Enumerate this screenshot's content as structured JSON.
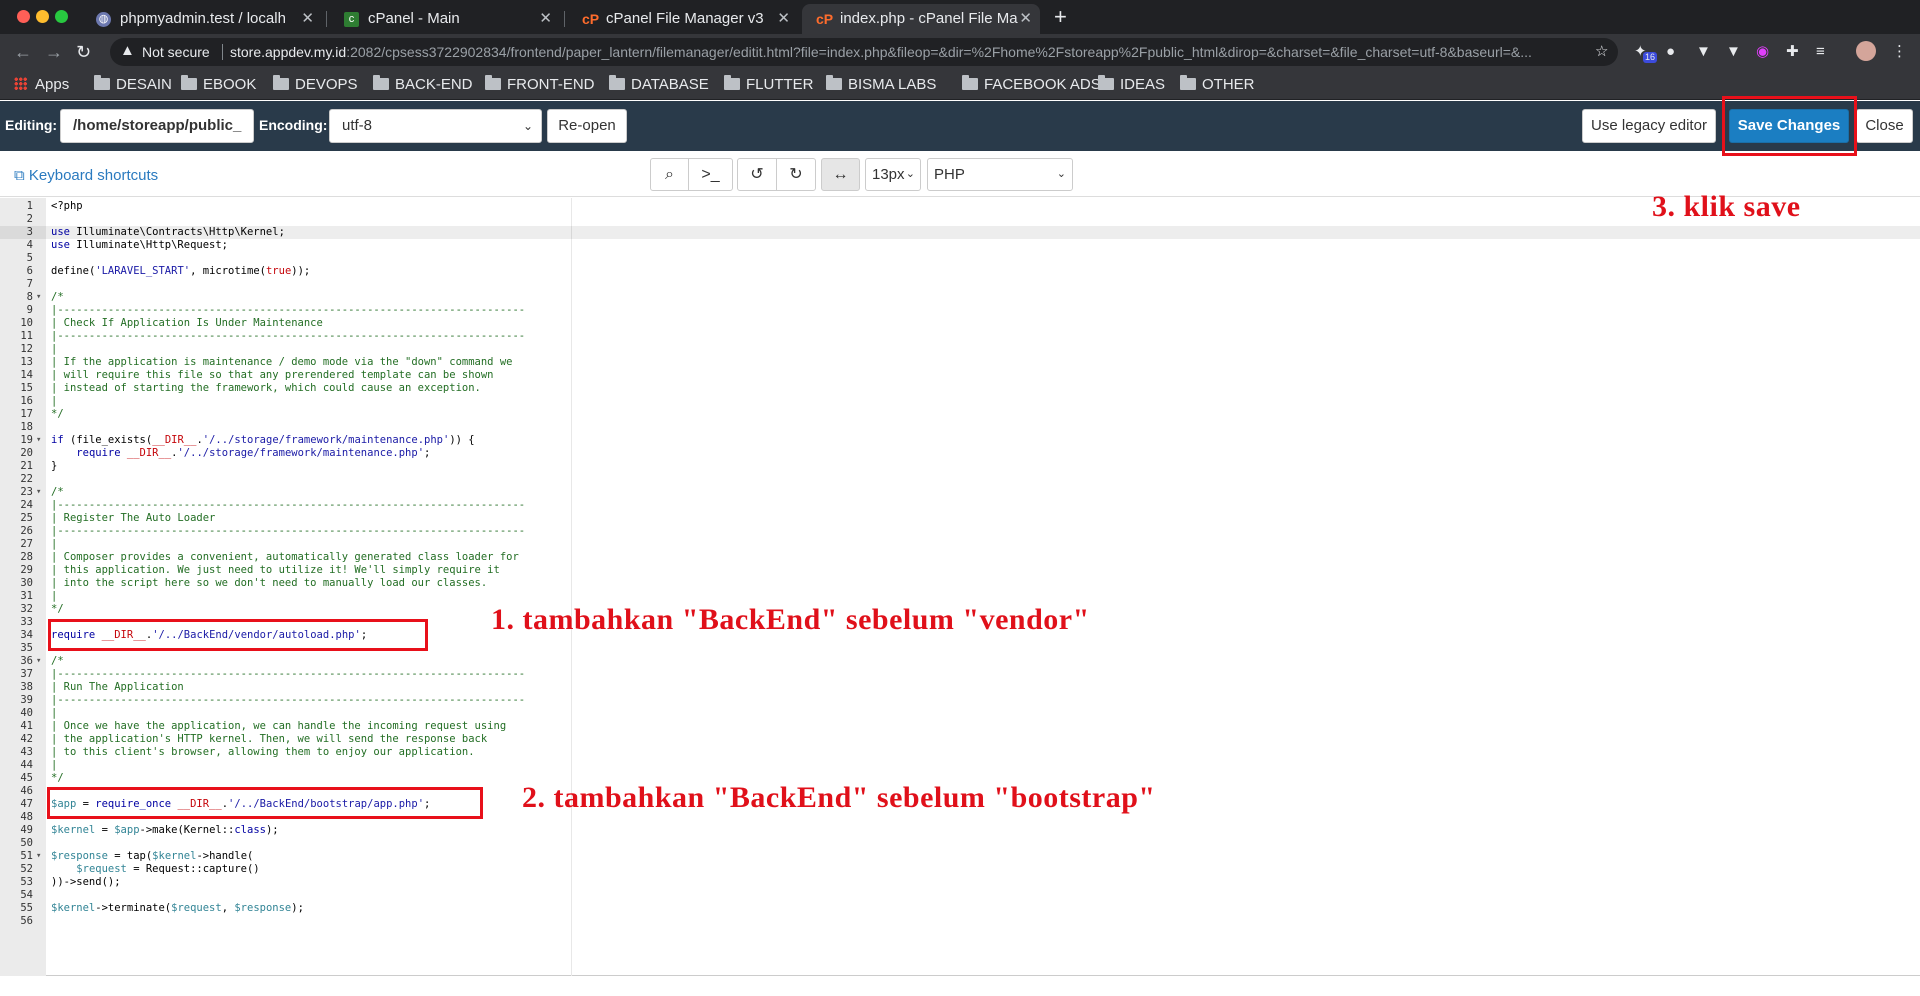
{
  "browser": {
    "tabs": [
      {
        "title": "phpmyadmin.test / localh",
        "favicon": "phpmyadmin-icon",
        "active": false
      },
      {
        "title": "cPanel - Main",
        "favicon": "cpanel-icon",
        "active": false
      },
      {
        "title": "cPanel File Manager v3",
        "favicon": "cpanel-icon",
        "active": false
      },
      {
        "title": "index.php - cPanel File Ma",
        "favicon": "cpanel-icon",
        "active": true
      }
    ],
    "new_tab_label": "+",
    "security_label": "Not secure",
    "url_host": "store.appdev.my.id",
    "url_rest": ":2082/cpsess3722902834/frontend/paper_lantern/filemanager/editit.html?file=index.php&fileop=&dir=%2Fhome%2Fstoreapp%2Fpublic_html&dirop=&charset=&file_charset=utf-8&baseurl=&...",
    "extension_badge": "16"
  },
  "bookmarks": [
    {
      "label": "Apps",
      "icon": "apps-grid-icon"
    },
    {
      "label": "DESAIN",
      "icon": "folder-icon"
    },
    {
      "label": "EBOOK",
      "icon": "folder-icon"
    },
    {
      "label": "DEVOPS",
      "icon": "folder-icon"
    },
    {
      "label": "BACK-END",
      "icon": "folder-icon"
    },
    {
      "label": "FRONT-END",
      "icon": "folder-icon"
    },
    {
      "label": "DATABASE",
      "icon": "folder-icon"
    },
    {
      "label": "FLUTTER",
      "icon": "folder-icon"
    },
    {
      "label": "BISMA LABS",
      "icon": "folder-icon"
    },
    {
      "label": "FACEBOOK ADS",
      "icon": "folder-icon"
    },
    {
      "label": "IDEAS",
      "icon": "folder-icon"
    },
    {
      "label": "OTHER",
      "icon": "folder-icon"
    }
  ],
  "editor_header": {
    "editing_label": "Editing:",
    "editing_path": "/home/storeapp/public_",
    "encoding_label": "Encoding:",
    "encoding_value": "utf-8",
    "reopen_label": "Re-open",
    "legacy_label": "Use legacy editor",
    "save_label": "Save Changes",
    "close_label": "Close"
  },
  "editor_toolbar": {
    "keyboard_shortcuts": "Keyboard shortcuts",
    "font_size": "13px",
    "mode": "PHP"
  },
  "code_lines": [
    [
      [
        "",
        "<?php"
      ]
    ],
    [],
    [
      [
        "kw",
        "use"
      ],
      [
        "",
        " Illuminate\\Contracts\\Http\\Kernel;"
      ]
    ],
    [
      [
        "kw",
        "use"
      ],
      [
        "",
        " Illuminate\\Http\\Request;"
      ]
    ],
    [],
    [
      [
        "fn",
        "define"
      ],
      [
        "",
        "("
      ],
      [
        "str",
        "'LARAVEL_START'"
      ],
      [
        "",
        ", "
      ],
      [
        "fn",
        "microtime"
      ],
      [
        "",
        "("
      ],
      [
        "const",
        "true"
      ],
      [
        "",
        "));"
      ]
    ],
    [],
    [
      [
        "com",
        "/*"
      ]
    ],
    [
      [
        "com",
        "|--------------------------------------------------------------------------"
      ]
    ],
    [
      [
        "com",
        "| Check If Application Is Under Maintenance"
      ]
    ],
    [
      [
        "com",
        "|--------------------------------------------------------------------------"
      ]
    ],
    [
      [
        "com",
        "|"
      ]
    ],
    [
      [
        "com",
        "| If the application is maintenance / demo mode via the \"down\" command we"
      ]
    ],
    [
      [
        "com",
        "| will require this file so that any prerendered template can be shown"
      ]
    ],
    [
      [
        "com",
        "| instead of starting the framework, which could cause an exception."
      ]
    ],
    [
      [
        "com",
        "|"
      ]
    ],
    [
      [
        "com",
        "*/"
      ]
    ],
    [],
    [
      [
        "kw",
        "if"
      ],
      [
        "",
        " ("
      ],
      [
        "fn",
        "file_exists"
      ],
      [
        "",
        "("
      ],
      [
        "const",
        "__DIR__"
      ],
      [
        "",
        "."
      ],
      [
        "str",
        "'/../storage/framework/maintenance.php'"
      ],
      [
        "",
        ")) {"
      ]
    ],
    [
      [
        "",
        "    "
      ],
      [
        "kw",
        "require"
      ],
      [
        "",
        " "
      ],
      [
        "const",
        "__DIR__"
      ],
      [
        "",
        "."
      ],
      [
        "str",
        "'/../storage/framework/maintenance.php'"
      ],
      [
        "",
        ";"
      ]
    ],
    [
      [
        "",
        "}"
      ]
    ],
    [],
    [
      [
        "com",
        "/*"
      ]
    ],
    [
      [
        "com",
        "|--------------------------------------------------------------------------"
      ]
    ],
    [
      [
        "com",
        "| Register The Auto Loader"
      ]
    ],
    [
      [
        "com",
        "|--------------------------------------------------------------------------"
      ]
    ],
    [
      [
        "com",
        "|"
      ]
    ],
    [
      [
        "com",
        "| Composer provides a convenient, automatically generated class loader for"
      ]
    ],
    [
      [
        "com",
        "| this application. We just need to utilize it! We'll simply require it"
      ]
    ],
    [
      [
        "com",
        "| into the script here so we don't need to manually load our classes."
      ]
    ],
    [
      [
        "com",
        "|"
      ]
    ],
    [
      [
        "com",
        "*/"
      ]
    ],
    [],
    [
      [
        "kw",
        "require"
      ],
      [
        "",
        " "
      ],
      [
        "const",
        "__DIR__"
      ],
      [
        "",
        "."
      ],
      [
        "str",
        "'/../BackEnd/vendor/autoload.php'"
      ],
      [
        "",
        ";"
      ]
    ],
    [],
    [
      [
        "com",
        "/*"
      ]
    ],
    [
      [
        "com",
        "|--------------------------------------------------------------------------"
      ]
    ],
    [
      [
        "com",
        "| Run The Application"
      ]
    ],
    [
      [
        "com",
        "|--------------------------------------------------------------------------"
      ]
    ],
    [
      [
        "com",
        "|"
      ]
    ],
    [
      [
        "com",
        "| Once we have the application, we can handle the incoming request using"
      ]
    ],
    [
      [
        "com",
        "| the application's HTTP kernel. Then, we will send the response back"
      ]
    ],
    [
      [
        "com",
        "| to this client's browser, allowing them to enjoy our application."
      ]
    ],
    [
      [
        "com",
        "|"
      ]
    ],
    [
      [
        "com",
        "*/"
      ]
    ],
    [],
    [
      [
        "var",
        "$app"
      ],
      [
        "",
        " = "
      ],
      [
        "kw",
        "require_once"
      ],
      [
        "",
        " "
      ],
      [
        "const",
        "__DIR__"
      ],
      [
        "",
        "."
      ],
      [
        "str",
        "'/../BackEnd/bootstrap/app.php'"
      ],
      [
        "",
        ";"
      ]
    ],
    [],
    [
      [
        "var",
        "$kernel"
      ],
      [
        "",
        " = "
      ],
      [
        "var",
        "$app"
      ],
      [
        "",
        "->make(Kernel::"
      ],
      [
        "kw",
        "class"
      ],
      [
        "",
        ");"
      ]
    ],
    [],
    [
      [
        "var",
        "$response"
      ],
      [
        "",
        " = tap("
      ],
      [
        "var",
        "$kernel"
      ],
      [
        "",
        "->handle("
      ]
    ],
    [
      [
        "",
        "    "
      ],
      [
        "var",
        "$request"
      ],
      [
        "",
        " = Request::capture()"
      ]
    ],
    [
      [
        "",
        "))->send();"
      ]
    ],
    [],
    [
      [
        "var",
        "$kernel"
      ],
      [
        "",
        "->terminate("
      ],
      [
        "var",
        "$request"
      ],
      [
        "",
        ", "
      ],
      [
        "var",
        "$response"
      ],
      [
        "",
        ");"
      ]
    ],
    []
  ],
  "fold_lines": [
    8,
    19,
    23,
    36,
    51
  ],
  "annotations": {
    "step1": "1.  tambahkan  \"BackEnd\"  sebelum  \"vendor\"",
    "step2": "2.  tambahkan  \"BackEnd\"  sebelum  \"bootstrap\"",
    "step3": "3.  klik  save"
  },
  "colors": {
    "annotation": "#e0101a",
    "save_button": "#1b7ec2",
    "header_bg": "#293a4a"
  }
}
